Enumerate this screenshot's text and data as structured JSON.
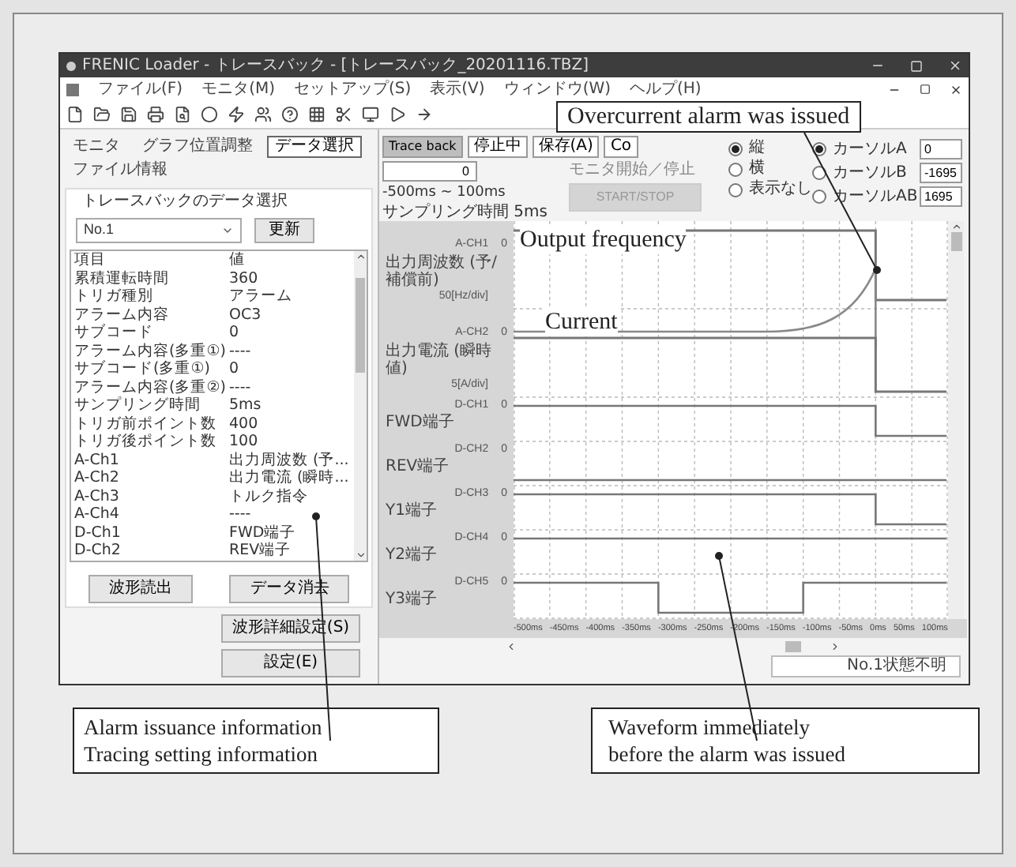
{
  "window": {
    "title": "FRENIC Loader - トレースバック - [トレースバック_20201116.TBZ]"
  },
  "menu": [
    "ファイル(F)",
    "モニタ(M)",
    "セットアップ(S)",
    "表示(V)",
    "ウィンドウ(W)",
    "ヘルプ(H)"
  ],
  "left_panel": {
    "tabs": [
      {
        "label": "モニタ",
        "selected": false
      },
      {
        "label": "グラフ位置調整",
        "selected": false
      },
      {
        "label": "データ選択",
        "selected": true
      },
      {
        "label": "ファイル情報",
        "selected": false
      }
    ],
    "data_select_label": "トレースバックのデータ選択",
    "select": {
      "value": "No.1"
    },
    "refresh_button": "更新",
    "table": {
      "columns": [
        "項目",
        "値"
      ],
      "rows": [
        [
          "累積運転時間",
          "360"
        ],
        [
          "トリガ種別",
          "アラーム"
        ],
        [
          "アラーム内容",
          "OC3"
        ],
        [
          "サブコード",
          "0"
        ],
        [
          "アラーム内容(多重①)",
          "----"
        ],
        [
          "サブコード(多重①)",
          "0"
        ],
        [
          "アラーム内容(多重②)",
          "----"
        ],
        [
          "サンプリング時間",
          "5ms"
        ],
        [
          "トリガ前ポイント数",
          "400"
        ],
        [
          "トリガ後ポイント数",
          "100"
        ],
        [
          "A-Ch1",
          "出力周波数 (予..."
        ],
        [
          "A-Ch2",
          "出力電流 (瞬時..."
        ],
        [
          "A-Ch3",
          "トルク指令"
        ],
        [
          "A-Ch4",
          "----"
        ],
        [
          "D-Ch1",
          "FWD端子"
        ],
        [
          "D-Ch2",
          "REV端子"
        ]
      ]
    },
    "buttons": [
      "波形読出",
      "データ消去"
    ],
    "side_buttons": [
      "波形詳細設定(S)",
      "設定(E)"
    ]
  },
  "trace": {
    "buttons": [
      "Trace back",
      "停止中",
      "保存(A)",
      "Co"
    ],
    "time_field": "0",
    "range": "-500ms ~ 100ms",
    "sampling": "サンプリング時間 5ms",
    "monitor_label": "モニタ開始／停止",
    "start_stop": {
      "label": "START/STOP",
      "disabled": true
    },
    "orientation": [
      {
        "label": "縦",
        "selected": true
      },
      {
        "label": "横",
        "selected": false
      },
      {
        "label": "表示なし",
        "selected": false
      }
    ],
    "cursors": [
      {
        "label": "カーソルA",
        "selected": true,
        "value": "0"
      },
      {
        "label": "カーソルB",
        "selected": false,
        "value": "-1695"
      },
      {
        "label": "カーソルAB",
        "selected": false,
        "value": "1695"
      }
    ]
  },
  "chart": {
    "channels": [
      {
        "kind": "analog",
        "channel": "A-CH1",
        "name": "出力周波数 (予/補償前)",
        "scale": "50[Hz/div]",
        "zero": "0"
      },
      {
        "kind": "analog",
        "channel": "A-CH2",
        "name": "出力電流 (瞬時値)",
        "scale": "5[A/div]",
        "zero": "0"
      },
      {
        "kind": "digital",
        "channel": "D-CH1",
        "name": "FWD端子",
        "zero": "0"
      },
      {
        "kind": "digital",
        "channel": "D-CH2",
        "name": "REV端子",
        "zero": "0"
      },
      {
        "kind": "digital",
        "channel": "D-CH3",
        "name": "Y1端子",
        "zero": "0"
      },
      {
        "kind": "digital",
        "channel": "D-CH4",
        "name": "Y2端子",
        "zero": "0"
      },
      {
        "kind": "digital",
        "channel": "D-CH5",
        "name": "Y3端子",
        "zero": "0"
      }
    ],
    "x_ticks": [
      "-500ms",
      "-450ms",
      "-400ms",
      "-350ms",
      "-300ms",
      "-250ms",
      "-200ms",
      "-150ms",
      "-100ms",
      "-50ms",
      "0ms",
      "50ms",
      "100ms"
    ]
  },
  "status_bar": {
    "text": "No.1状態不明"
  },
  "annotations": {
    "overcurrent": "Overcurrent alarm was issued",
    "output_frequency": "Output frequency",
    "current": "Current",
    "left_note": [
      "Alarm issuance information",
      "Tracing setting information"
    ],
    "right_note": [
      "Waveform immediately",
      "before the alarm was issued"
    ]
  }
}
